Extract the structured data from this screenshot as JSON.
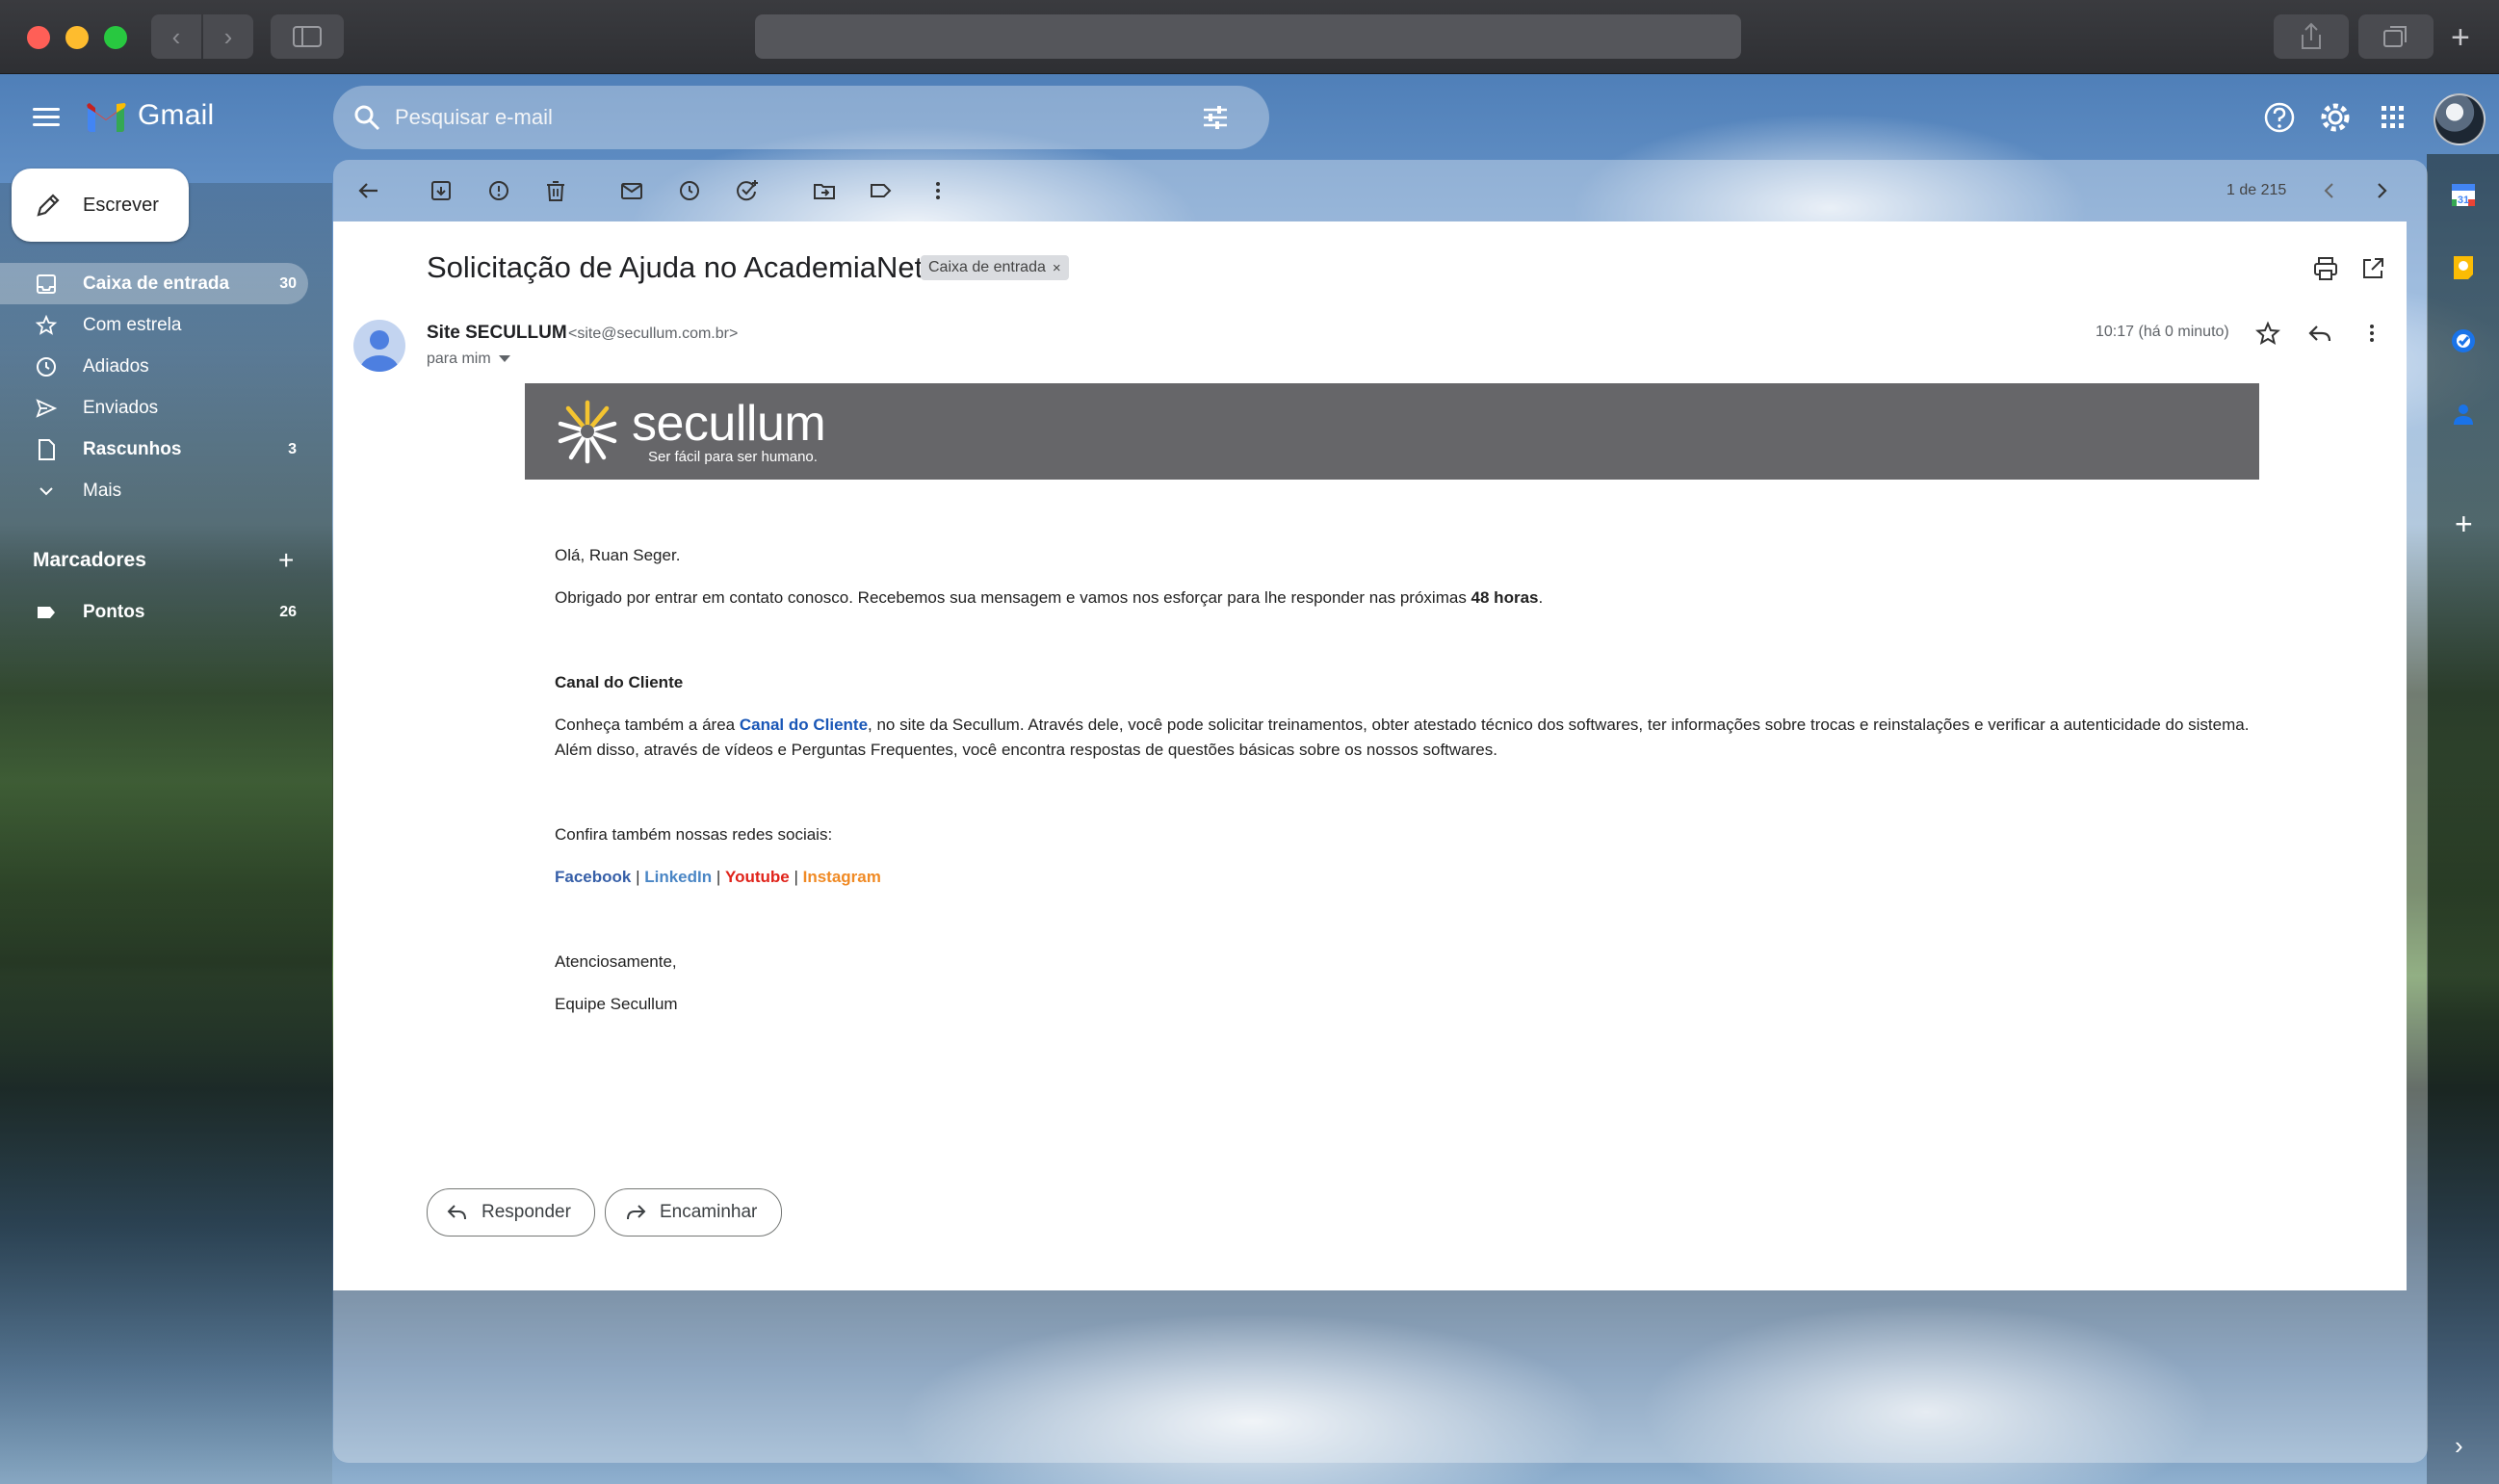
{
  "app": {
    "name": "Gmail"
  },
  "search": {
    "placeholder": "Pesquisar e-mail"
  },
  "compose": {
    "label": "Escrever"
  },
  "nav": {
    "items": [
      {
        "label": "Caixa de entrada",
        "count": "30"
      },
      {
        "label": "Com estrela",
        "count": ""
      },
      {
        "label": "Adiados",
        "count": ""
      },
      {
        "label": "Enviados",
        "count": ""
      },
      {
        "label": "Rascunhos",
        "count": "3"
      },
      {
        "label": "Mais",
        "count": ""
      }
    ],
    "labels_title": "Marcadores",
    "labels": [
      {
        "label": "Pontos",
        "count": "26"
      }
    ]
  },
  "toolbar": {
    "pager": "1 de 215"
  },
  "email": {
    "subject": "Solicitação de Ajuda no AcademiaNet",
    "chip": "Caixa de entrada",
    "chip_close": "×",
    "sender_name": "Site SECULLUM",
    "sender_email": "<site@secullum.com.br>",
    "to": "para mim",
    "time": "10:17 (há 0 minuto)",
    "banner_brand": "secullum",
    "banner_tagline": "Ser fácil para ser humano.",
    "greeting": "Olá, Ruan Seger.",
    "thanks_pre": "Obrigado por entrar em contato conosco. Recebemos sua mensagem e vamos nos esforçar para lhe responder nas próximas ",
    "thanks_bold": "48 horas",
    "thanks_post": ".",
    "section_title": "Canal do Cliente",
    "section_pre": "Conheça também a área ",
    "section_link": "Canal do Cliente",
    "section_post": ", no site da Secullum. Através dele, você pode solicitar treinamentos, obter atestado técnico dos softwares, ter informações sobre trocas e reinstalações e verificar a autenticidade do sistema. Além disso, através de vídeos e Perguntas Frequentes, você encontra respostas de questões básicas sobre os nossos softwares.",
    "social_intro": "Confira também nossas redes sociais:",
    "social": {
      "facebook": "Facebook",
      "linkedin": "LinkedIn",
      "youtube": "Youtube",
      "instagram": "Instagram",
      "separator": " | "
    },
    "closing": "Atenciosamente,",
    "signature": "Equipe Secullum"
  },
  "actions": {
    "reply": "Responder",
    "forward": "Encaminhar"
  },
  "colors": {
    "accent_link": "#1a57b7",
    "facebook": "#365fa8",
    "linkedin": "#4a86c5",
    "youtube": "#e0231a",
    "instagram": "#f08a24",
    "banner": "#666669"
  }
}
